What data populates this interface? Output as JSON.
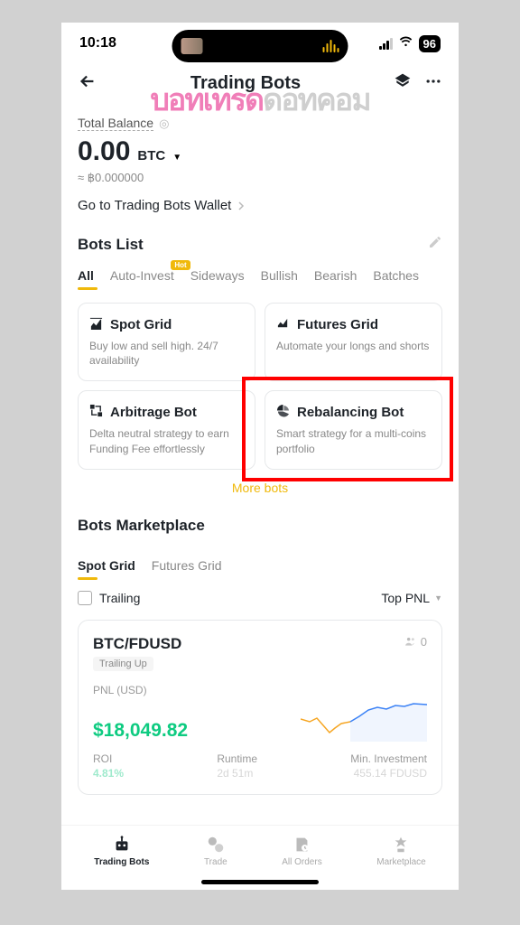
{
  "status": {
    "time": "10:18",
    "battery": "96"
  },
  "header": {
    "title": "Trading Bots"
  },
  "balance": {
    "label": "Total Balance",
    "amount": "0.00",
    "currency": "BTC",
    "fiat": "≈ ฿0.000000",
    "wallet_link": "Go to Trading Bots Wallet"
  },
  "bots": {
    "list_title": "Bots List",
    "tabs": {
      "all": "All",
      "auto": "Auto-Invest",
      "badge": "Hot",
      "sideways": "Sideways",
      "bullish": "Bullish",
      "bearish": "Bearish",
      "batches": "Batches"
    },
    "cards": {
      "spot": {
        "title": "Spot Grid",
        "desc": "Buy low and sell high. 24/7 availability"
      },
      "futures": {
        "title": "Futures Grid",
        "desc": "Automate your longs and shorts"
      },
      "arbitrage": {
        "title": "Arbitrage Bot",
        "desc": "Delta neutral strategy to earn Funding Fee effortlessly"
      },
      "rebalancing": {
        "title": "Rebalancing Bot",
        "desc": "Smart strategy for a multi-coins portfolio"
      }
    },
    "more": "More bots"
  },
  "marketplace": {
    "title": "Bots Marketplace",
    "tabs": {
      "spot": "Spot Grid",
      "futures": "Futures Grid"
    },
    "filter": {
      "trailing": "Trailing",
      "sort": "Top PNL"
    },
    "card": {
      "pair": "BTC/FDUSD",
      "copies": "0",
      "tag": "Trailing Up",
      "pnl_label": "PNL (USD)",
      "pnl_value": "$18,049.82",
      "roi_label": "ROI",
      "roi_value": "4.81%",
      "runtime_label": "Runtime",
      "runtime_value": "2d 51m",
      "min_label": "Min. Investment",
      "min_value": "455.14 FDUSD"
    }
  },
  "nav": {
    "trading_bots": "Trading Bots",
    "trade": "Trade",
    "all_orders": "All Orders",
    "marketplace": "Marketplace"
  }
}
